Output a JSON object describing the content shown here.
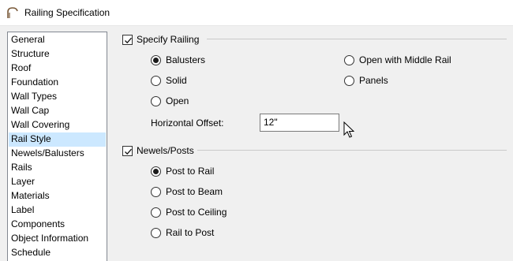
{
  "window": {
    "title": "Railing Specification"
  },
  "sidebar": {
    "items": [
      {
        "label": "General"
      },
      {
        "label": "Structure"
      },
      {
        "label": "Roof"
      },
      {
        "label": "Foundation"
      },
      {
        "label": "Wall Types"
      },
      {
        "label": "Wall Cap"
      },
      {
        "label": "Wall Covering"
      },
      {
        "label": "Rail Style",
        "selected": true
      },
      {
        "label": "Newels/Balusters"
      },
      {
        "label": "Rails"
      },
      {
        "label": "Layer"
      },
      {
        "label": "Materials"
      },
      {
        "label": "Label"
      },
      {
        "label": "Components"
      },
      {
        "label": "Object Information"
      },
      {
        "label": "Schedule"
      }
    ]
  },
  "specify_railing": {
    "label": "Specify Railing",
    "checked": true,
    "options": [
      {
        "label": "Balusters",
        "selected": true
      },
      {
        "label": "Solid",
        "selected": false
      },
      {
        "label": "Open",
        "selected": false
      },
      {
        "label": "Open with Middle Rail",
        "selected": false
      },
      {
        "label": "Panels",
        "selected": false
      }
    ],
    "horizontal_offset": {
      "label": "Horizontal Offset:",
      "value": "12\""
    }
  },
  "newels_posts": {
    "label": "Newels/Posts",
    "checked": true,
    "options": [
      {
        "label": "Post to Rail",
        "selected": true
      },
      {
        "label": "Post to Beam",
        "selected": false
      },
      {
        "label": "Post to Ceiling",
        "selected": false
      },
      {
        "label": "Rail to Post",
        "selected": false
      }
    ]
  },
  "colors": {
    "selection": "#cce8ff",
    "window_bg": "#f0f0f0"
  }
}
